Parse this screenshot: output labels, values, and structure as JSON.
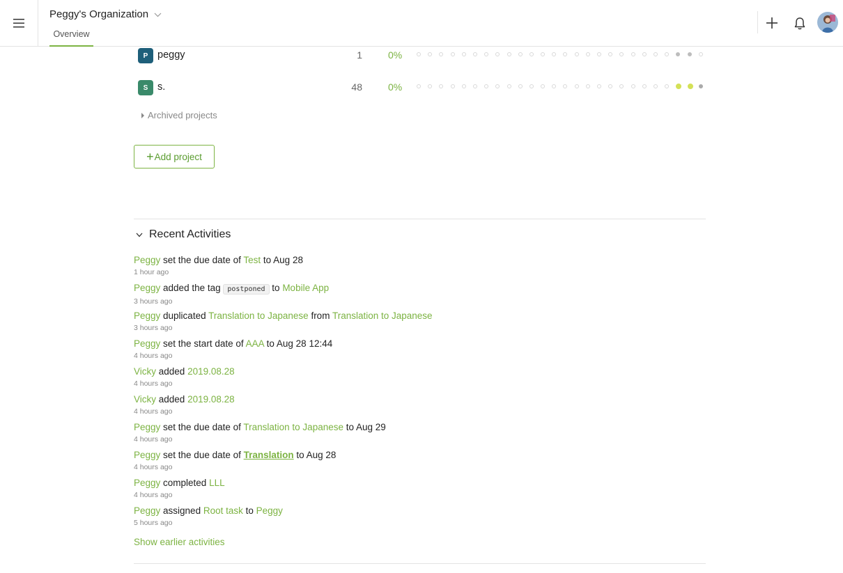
{
  "header": {
    "org_name": "Peggy's Organization",
    "tab_overview": "Overview"
  },
  "colors": {
    "accent": "#7cb342",
    "badge_p": "#1e5f7a",
    "badge_s": "#3a8a6a"
  },
  "projects": [
    {
      "initial": "P",
      "name": "peggy",
      "count": "1",
      "percent": "0%"
    },
    {
      "initial": "S",
      "name": "s.",
      "count": "48",
      "percent": "0%"
    }
  ],
  "archived_label": "Archived projects",
  "add_project_label": "Add project",
  "recent": {
    "title": "Recent Activities",
    "show_earlier": "Show earlier activities",
    "items": [
      {
        "user": "Peggy",
        "t1": " set the due date of ",
        "l1": "Test",
        "t2": " to Aug 28",
        "time": "1 hour ago"
      },
      {
        "user": "Peggy",
        "t1": " added the tag ",
        "tag": "postponed",
        "t2": " to ",
        "l1": "Mobile App",
        "time": "3 hours ago"
      },
      {
        "user": "Peggy",
        "t1": " duplicated ",
        "l1": "Translation to Japanese",
        "t2": " from ",
        "l2": "Translation to Japanese",
        "time": "3 hours ago"
      },
      {
        "user": "Peggy",
        "t1": " set the start date of ",
        "l1": "AAA",
        "t2": " to Aug 28 12:44",
        "time": "4 hours ago"
      },
      {
        "user": "Vicky",
        "t1": " added ",
        "l1": "2019.08.28",
        "time": "4 hours ago"
      },
      {
        "user": "Vicky",
        "t1": " added ",
        "l1": "2019.08.28",
        "time": "4 hours ago"
      },
      {
        "user": "Peggy",
        "t1": " set the due date of ",
        "l1": "Translation to Japanese",
        "t2": " to Aug 29",
        "time": "4 hours ago"
      },
      {
        "user": "Peggy",
        "t1": " set the due date of ",
        "l1": "Translation",
        "t2": " to Aug 28",
        "time": "4 hours ago"
      },
      {
        "user": "Peggy",
        "t1": " completed ",
        "l1": "LLL",
        "time": "4 hours ago"
      },
      {
        "user": "Peggy",
        "t1": " assigned ",
        "l1": "Root task",
        "t2": " to ",
        "l2": "Peggy",
        "time": "5 hours ago"
      }
    ]
  }
}
